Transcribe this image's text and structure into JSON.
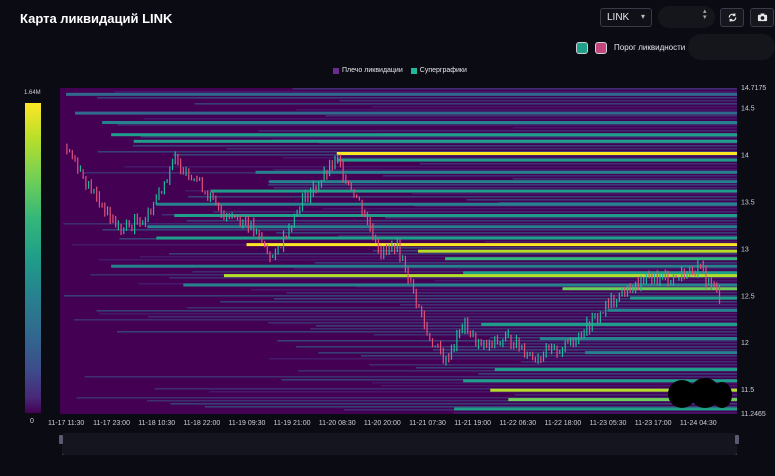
{
  "title": "Карта ликвидаций LINK",
  "controls": {
    "symbol_select": "LINK",
    "refresh_icon": "refresh-icon",
    "camera_icon": "camera-icon",
    "threshold_label": "Порог ликвидности",
    "swatch_colors": [
      "#1fa089",
      "#c2467b"
    ]
  },
  "legend": [
    {
      "label": "Плечо ликвидации",
      "color": "#6a2c91"
    },
    {
      "label": "Суперграфики",
      "color": "#1fb89a"
    }
  ],
  "colorbar": {
    "max_label": "1.64M",
    "min_label": "0"
  },
  "colors": {
    "background": "#440154",
    "candle_up": "#1fb89a",
    "candle_down": "#e0507a"
  },
  "chart_data": {
    "type": "heatmap",
    "title": "Карта ликвидаций LINK",
    "x_tick_labels": [
      "11-17 11:30",
      "11-17 23:00",
      "11-18 10:30",
      "11-18 22:00",
      "11-19 09:30",
      "11-19 21:00",
      "11-20 08:30",
      "11-20 20:00",
      "11-21 07:30",
      "11-21 19:00",
      "11-22 06:30",
      "11-22 18:00",
      "11-23 05:30",
      "11-23 17:00",
      "11-24 04:30"
    ],
    "y_tick_labels": [
      "14.7175",
      "14.5",
      "14",
      "13.5",
      "13",
      "12.5",
      "12",
      "11.5",
      "11.2465"
    ],
    "ylim": [
      11.2465,
      14.7175
    ],
    "y_ticks": [
      14.7175,
      14.5,
      14,
      13.5,
      13,
      12.5,
      12,
      11.5,
      11.2465
    ],
    "price_path": {
      "x_index": [
        0,
        0.6,
        1.2,
        1.8,
        2.4,
        2.9,
        3.4,
        4.0,
        4.6,
        5.2,
        5.6,
        6.0,
        6.5,
        7.0,
        7.3,
        7.6,
        8.0,
        8.4,
        8.8,
        9.2,
        9.8,
        10.4,
        11.0,
        11.6,
        12.2,
        12.6,
        13.0,
        13.5,
        14.0,
        14.5
      ],
      "price": [
        14.1,
        13.6,
        13.2,
        13.35,
        13.95,
        13.75,
        13.4,
        13.3,
        12.9,
        13.5,
        13.7,
        13.95,
        13.5,
        12.95,
        13.05,
        12.7,
        12.1,
        11.8,
        12.2,
        11.95,
        12.05,
        11.85,
        11.95,
        12.2,
        12.5,
        12.6,
        12.7,
        12.7,
        12.8,
        12.5
      ]
    },
    "liquidation_levels": [
      {
        "price": 14.65,
        "x_start_index": 0.0,
        "intensity": 0.3
      },
      {
        "price": 14.45,
        "x_start_index": 0.2,
        "intensity": 0.35
      },
      {
        "price": 14.35,
        "x_start_index": 0.8,
        "intensity": 0.45
      },
      {
        "price": 14.22,
        "x_start_index": 1.0,
        "intensity": 0.55
      },
      {
        "price": 14.15,
        "x_start_index": 1.5,
        "intensity": 0.5
      },
      {
        "price": 14.02,
        "x_start_index": 6.0,
        "intensity": 1.0
      },
      {
        "price": 13.95,
        "x_start_index": 6.0,
        "intensity": 0.55
      },
      {
        "price": 13.82,
        "x_start_index": 4.2,
        "intensity": 0.45
      },
      {
        "price": 13.72,
        "x_start_index": 4.5,
        "intensity": 0.4
      },
      {
        "price": 13.62,
        "x_start_index": 3.2,
        "intensity": 0.5
      },
      {
        "price": 13.48,
        "x_start_index": 2.0,
        "intensity": 0.45
      },
      {
        "price": 13.36,
        "x_start_index": 2.4,
        "intensity": 0.5
      },
      {
        "price": 13.24,
        "x_start_index": 1.8,
        "intensity": 0.45
      },
      {
        "price": 13.12,
        "x_start_index": 2.0,
        "intensity": 0.55
      },
      {
        "price": 13.05,
        "x_start_index": 4.0,
        "intensity": 0.95
      },
      {
        "price": 12.98,
        "x_start_index": 7.8,
        "intensity": 0.9
      },
      {
        "price": 12.9,
        "x_start_index": 8.4,
        "intensity": 0.7
      },
      {
        "price": 12.82,
        "x_start_index": 1.0,
        "intensity": 0.4
      },
      {
        "price": 12.75,
        "x_start_index": 8.8,
        "intensity": 0.6
      },
      {
        "price": 12.72,
        "x_start_index": 3.5,
        "intensity": 0.85
      },
      {
        "price": 12.62,
        "x_start_index": 2.6,
        "intensity": 0.45
      },
      {
        "price": 12.58,
        "x_start_index": 11.0,
        "intensity": 0.8
      },
      {
        "price": 12.48,
        "x_start_index": 12.5,
        "intensity": 0.5
      },
      {
        "price": 12.35,
        "x_start_index": 12.0,
        "intensity": 0.45
      },
      {
        "price": 12.2,
        "x_start_index": 9.2,
        "intensity": 0.55
      },
      {
        "price": 12.05,
        "x_start_index": 10.5,
        "intensity": 0.45
      },
      {
        "price": 11.9,
        "x_start_index": 11.5,
        "intensity": 0.45
      },
      {
        "price": 11.72,
        "x_start_index": 9.5,
        "intensity": 0.6
      },
      {
        "price": 11.6,
        "x_start_index": 8.8,
        "intensity": 0.55
      },
      {
        "price": 11.5,
        "x_start_index": 9.4,
        "intensity": 0.85
      },
      {
        "price": 11.4,
        "x_start_index": 9.8,
        "intensity": 0.75
      },
      {
        "price": 11.3,
        "x_start_index": 8.6,
        "intensity": 0.5
      }
    ],
    "colorbar_range": [
      0,
      1640000
    ],
    "grid": false,
    "legend_position": "top-center"
  }
}
